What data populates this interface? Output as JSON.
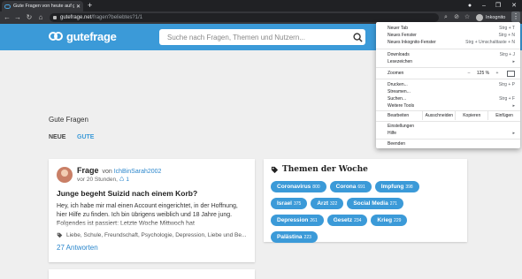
{
  "browser": {
    "tab_title": "Gute Fragen von heute auf gutef...",
    "url_host": "gutefrage.net",
    "url_path": "/fragen?beliebtes?1/1",
    "profile_label": "Inkognito"
  },
  "site": {
    "logo_text": "gutefrage",
    "search_placeholder": "Suche nach Fragen, Themen und Nutzern...",
    "brand_color": "#3b9ad8"
  },
  "page": {
    "section_title": "Gute Fragen",
    "tab_new": "NEUE",
    "tab_good": "GUTE"
  },
  "question": {
    "label": "Frage",
    "by": "von",
    "author": "IchBinSarah2002",
    "time": "vor 20 Stunden,",
    "votes": "1",
    "title": "Junge begeht Suizid nach einem Korb?",
    "body": "Hey,  ich habe mir mal einen Account eingerichtet, in der Hoffnung, hier Hilfe zu finden.  Ich bin übrigens weiblich und 18 Jahre jung.  Folgendes ist passiert: Letzte Woche Mittwoch hat",
    "tags": "Liebe, Schule, Freundschaft, Psychologie, Depression, Liebe und Be...",
    "answers": "27 Antworten"
  },
  "topics": {
    "title": "Themen der Woche",
    "items": [
      {
        "name": "Coronavirus",
        "count": "800"
      },
      {
        "name": "Corona",
        "count": "691"
      },
      {
        "name": "Impfung",
        "count": "398"
      },
      {
        "name": "Israel",
        "count": "375"
      },
      {
        "name": "Arzt",
        "count": "322"
      },
      {
        "name": "Social Media",
        "count": "271"
      },
      {
        "name": "Depression",
        "count": "261"
      },
      {
        "name": "Gesetz",
        "count": "234"
      },
      {
        "name": "Krieg",
        "count": "229"
      },
      {
        "name": "Palästina",
        "count": "223"
      }
    ]
  },
  "menu": {
    "new_tab": "Neuer Tab",
    "new_tab_sc": "Strg + T",
    "new_window": "Neues Fenster",
    "new_window_sc": "Strg + N",
    "new_incognito": "Neues Inkognito-Fenster",
    "new_incognito_sc": "Strg + Umschalttaste + N",
    "downloads": "Downloads",
    "downloads_sc": "Strg + J",
    "bookmarks": "Lesezeichen",
    "zoom": "Zoomen",
    "zoom_minus": "–",
    "zoom_value": "125 %",
    "zoom_plus": "+",
    "print": "Drucken...",
    "print_sc": "Strg + P",
    "cast": "Streamen...",
    "find": "Suchen...",
    "find_sc": "Strg + F",
    "more_tools": "Weitere Tools",
    "edit": "Bearbeiten",
    "cut": "Ausschneiden",
    "copy": "Kopieren",
    "paste": "Einfügen",
    "settings": "Einstellungen",
    "help": "Hilfe",
    "exit": "Beenden"
  }
}
